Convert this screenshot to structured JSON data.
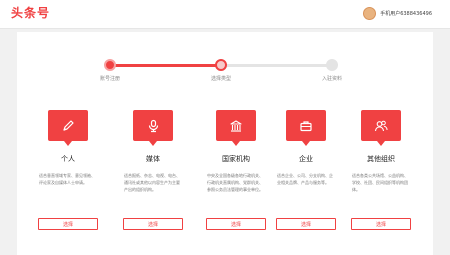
{
  "header": {
    "logo": "头条号",
    "username": "手机用户6388436496"
  },
  "steps": [
    {
      "label": "账号注册",
      "state": "done"
    },
    {
      "label": "选择类型",
      "state": "current"
    },
    {
      "label": "入驻资料",
      "state": "todo"
    }
  ],
  "cards": [
    {
      "title": "个人",
      "icon": "pen-icon",
      "desc": "适合垂直领域专家、意见领袖、评论家及自媒体人士申请。",
      "button": "选择"
    },
    {
      "title": "媒体",
      "icon": "mic-icon",
      "desc": "适合报纸、杂志、电视、电台、通讯社或其他以内容生产为主要产出的组织机构。",
      "button": "选择"
    },
    {
      "title": "国家机构",
      "icon": "building-icon",
      "desc": "中央及全国各级各地行政机关、行政机关直属机构、党群机关、参照公务员法管理的事业单位。",
      "button": "选择"
    },
    {
      "title": "企业",
      "icon": "briefcase-icon",
      "desc": "适合企业、公司、分支机构、企业相关品牌、产品与服务等。",
      "button": "选择"
    },
    {
      "title": "其他组织",
      "icon": "people-icon",
      "desc": "适合各类公共场馆、公益机构、学校、社团、民间组织等机构团体。",
      "button": "选择"
    }
  ],
  "colors": {
    "accent": "#f04142"
  }
}
